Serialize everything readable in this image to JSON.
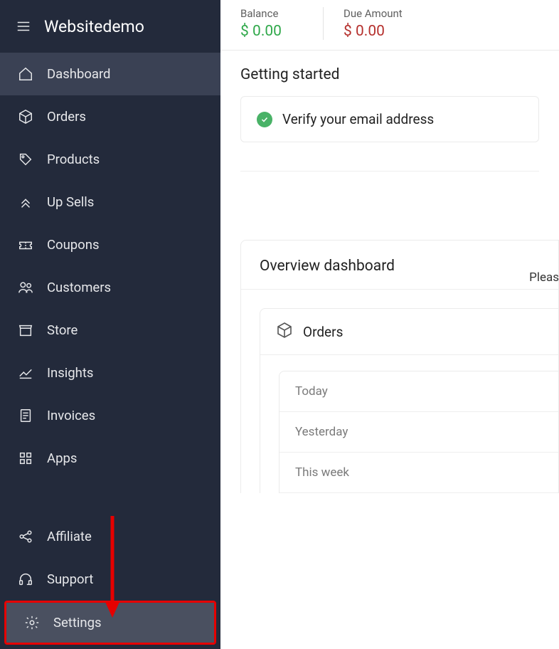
{
  "sidebar": {
    "title": "Websitedemo",
    "items": [
      {
        "label": "Dashboard"
      },
      {
        "label": "Orders"
      },
      {
        "label": "Products"
      },
      {
        "label": "Up Sells"
      },
      {
        "label": "Coupons"
      },
      {
        "label": "Customers"
      },
      {
        "label": "Store"
      },
      {
        "label": "Insights"
      },
      {
        "label": "Invoices"
      },
      {
        "label": "Apps"
      }
    ],
    "bottom": [
      {
        "label": "Affiliate"
      },
      {
        "label": "Support"
      },
      {
        "label": "Settings"
      }
    ]
  },
  "balance": {
    "balance_label": "Balance",
    "balance_value": "$ 0.00",
    "due_label": "Due Amount",
    "due_value": "$ 0.00"
  },
  "getting_started": {
    "title": "Getting started",
    "item": "Verify your email address"
  },
  "truncated_text": "Pleas",
  "overview": {
    "title": "Overview dashboard",
    "orders_title": "Orders",
    "periods": [
      "Today",
      "Yesterday",
      "This week"
    ]
  }
}
